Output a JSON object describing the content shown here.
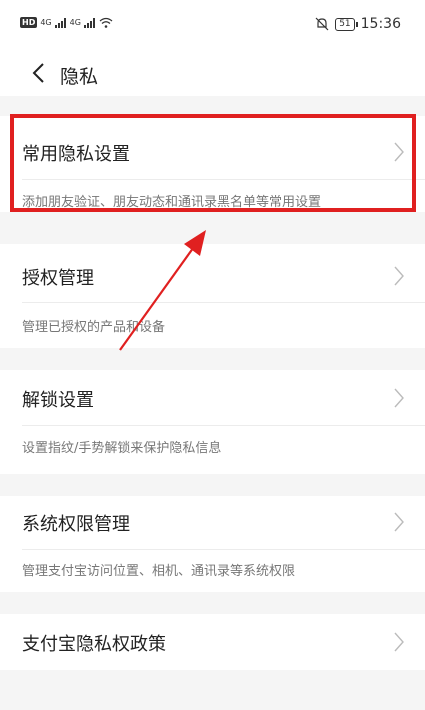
{
  "status_bar": {
    "hd": "HD",
    "sig1": "4G",
    "sig2": "4G",
    "battery": "51",
    "time": "15:36"
  },
  "nav": {
    "title": "隐私"
  },
  "sections": [
    {
      "title": "常用隐私设置",
      "desc": "添加朋友验证、朋友动态和通讯录黑名单等常用设置"
    },
    {
      "title": "授权管理",
      "desc": "管理已授权的产品和设备"
    },
    {
      "title": "解锁设置",
      "desc": "设置指纹/手势解锁来保护隐私信息"
    },
    {
      "title": "系统权限管理",
      "desc": "管理支付宝访问位置、相机、通讯录等系统权限"
    },
    {
      "title": "支付宝隐私权政策"
    }
  ],
  "colors": {
    "highlight": "#e02020",
    "background": "#f5f5f5",
    "card": "#ffffff"
  }
}
